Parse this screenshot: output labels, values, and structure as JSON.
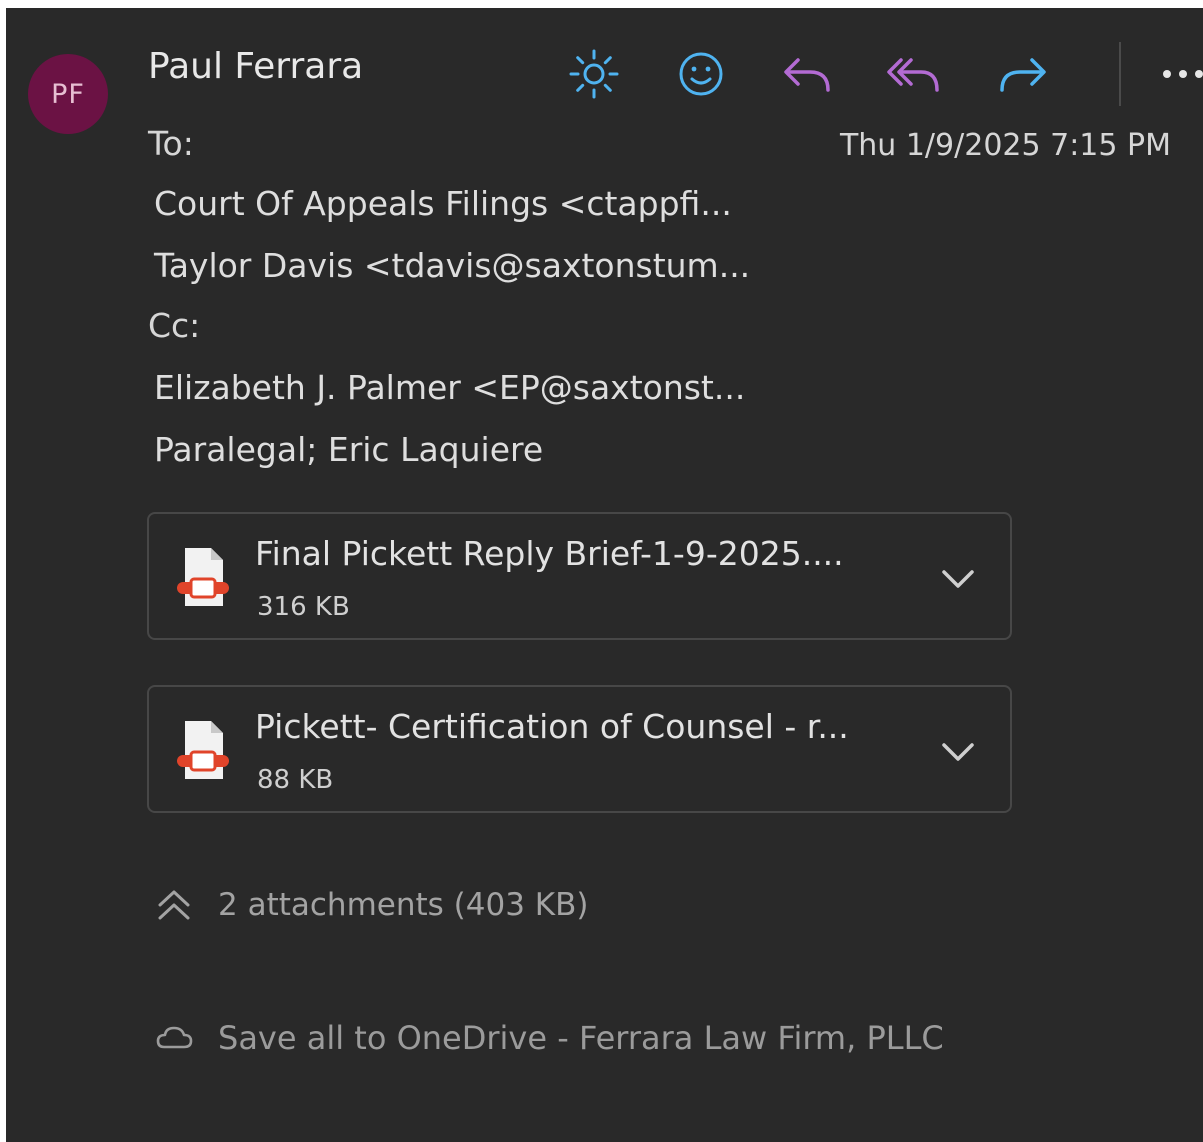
{
  "sender": {
    "initials": "PF",
    "name": "Paul Ferrara"
  },
  "toolbar": {
    "icons": [
      "sun-icon",
      "smiley-icon",
      "reply-icon",
      "reply-all-icon",
      "forward-icon",
      "more-icon"
    ],
    "colors": {
      "sun": "#4fb3f0",
      "smiley": "#4fb3f0",
      "reply": "#b36bd3",
      "reply_all": "#b36bd3",
      "forward": "#4fb3f0"
    }
  },
  "header": {
    "to_label": "To:",
    "date": "Thu 1/9/2025 7:15 PM",
    "to": [
      "Court Of Appeals Filings <ctappfi...",
      "Taylor Davis <tdavis@saxtonstum..."
    ],
    "cc_label": "Cc:",
    "cc": [
      "Elizabeth J. Palmer <EP@saxtonst...",
      "Paralegal;  Eric Laquiere"
    ]
  },
  "attachments": [
    {
      "name": "Final Pickett Reply Brief-1-9-2025....",
      "size": "316 KB",
      "icon": "pdf-file-icon"
    },
    {
      "name": "Pickett- Certification of Counsel - r...",
      "size": "88 KB",
      "icon": "pdf-file-icon"
    }
  ],
  "summary": {
    "text": "2 attachments (403 KB)",
    "icon": "collapse-icon"
  },
  "save": {
    "text": "Save all to OneDrive - Ferrara Law Firm, PLLC",
    "icon": "cloud-icon"
  },
  "colors": {
    "background": "#292929",
    "avatar": "#6b1244",
    "pdf_accent": "#e0442a"
  }
}
